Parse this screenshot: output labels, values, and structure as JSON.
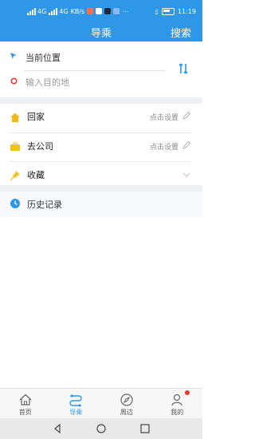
{
  "statusbar": {
    "net_labels": [
      "4G",
      "4G",
      "KB/s"
    ],
    "clock": "11:19",
    "icons": [
      "signal-icon",
      "signal-icon",
      "weibo-icon",
      "messenger-icon",
      "app-icon",
      "app-icon",
      "more-icon",
      "vibrate-icon",
      "battery-icon"
    ]
  },
  "header": {
    "title": "导乘",
    "search_label": "搜索"
  },
  "route": {
    "current_location": "当前位置",
    "destination_placeholder": "输入目的地"
  },
  "favorites": [
    {
      "label": "回家",
      "action": "点击设置",
      "icon": "home-icon",
      "trail": "edit-icon"
    },
    {
      "label": "去公司",
      "action": "点击设置",
      "icon": "briefcase-icon",
      "trail": "edit-icon"
    },
    {
      "label": "收藏",
      "action": "",
      "icon": "pin-icon",
      "trail": "chevron-down-icon"
    }
  ],
  "history": {
    "label": "历史记录"
  },
  "tabs": [
    {
      "label": "首页",
      "icon": "home-icon",
      "active": false
    },
    {
      "label": "导乘",
      "icon": "route-icon",
      "active": true
    },
    {
      "label": "周边",
      "icon": "compass-icon",
      "active": false
    },
    {
      "label": "我的",
      "icon": "profile-icon",
      "active": false,
      "badge": true
    }
  ],
  "colors": {
    "primary": "#2f97e8",
    "badge": "#e53935",
    "favorite_home": "#f2b81d",
    "favorite_work": "#f2c21b",
    "favorite_pin": "#f2c21b",
    "history": "#2f97e8"
  },
  "nav": [
    "back-icon",
    "home-icon",
    "recents-icon"
  ]
}
